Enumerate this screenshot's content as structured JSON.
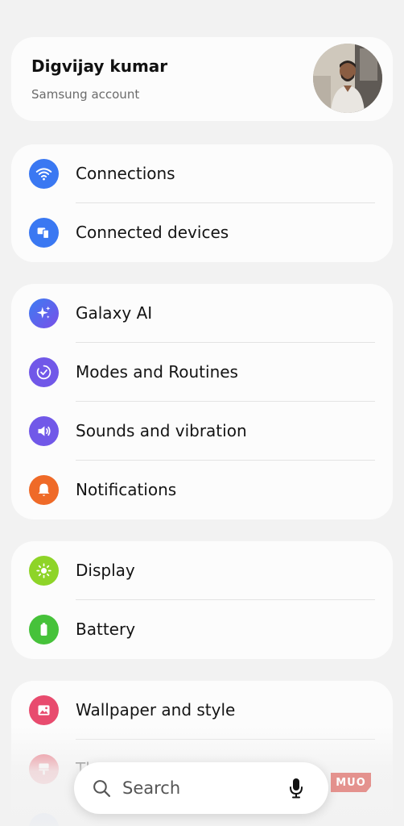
{
  "profile": {
    "name": "Digvijay kumar",
    "subtitle": "Samsung account"
  },
  "groups": [
    {
      "items": [
        {
          "label": "Connections",
          "icon": "wifi-icon",
          "color": "#3a78f2"
        },
        {
          "label": "Connected devices",
          "icon": "devices-icon",
          "color": "#3a78f2"
        }
      ]
    },
    {
      "items": [
        {
          "label": "Galaxy AI",
          "icon": "sparkle-icon",
          "color": "#4d6cf0"
        },
        {
          "label": "Modes and Routines",
          "icon": "check-circle-icon",
          "color": "#7158e8"
        },
        {
          "label": "Sounds and vibration",
          "icon": "speaker-icon",
          "color": "#7158e8"
        },
        {
          "label": "Notifications",
          "icon": "bell-icon",
          "color": "#ef6a28"
        }
      ]
    },
    {
      "items": [
        {
          "label": "Display",
          "icon": "sun-icon",
          "color": "#8ed428"
        },
        {
          "label": "Battery",
          "icon": "battery-icon",
          "color": "#46c23a"
        }
      ]
    },
    {
      "items": [
        {
          "label": "Wallpaper and style",
          "icon": "image-icon",
          "color": "#e84b6e"
        },
        {
          "label": "Th",
          "icon": "brush-icon",
          "color": "#e85a6a"
        }
      ]
    }
  ],
  "search": {
    "placeholder": "Search"
  },
  "watermark": "MUO"
}
